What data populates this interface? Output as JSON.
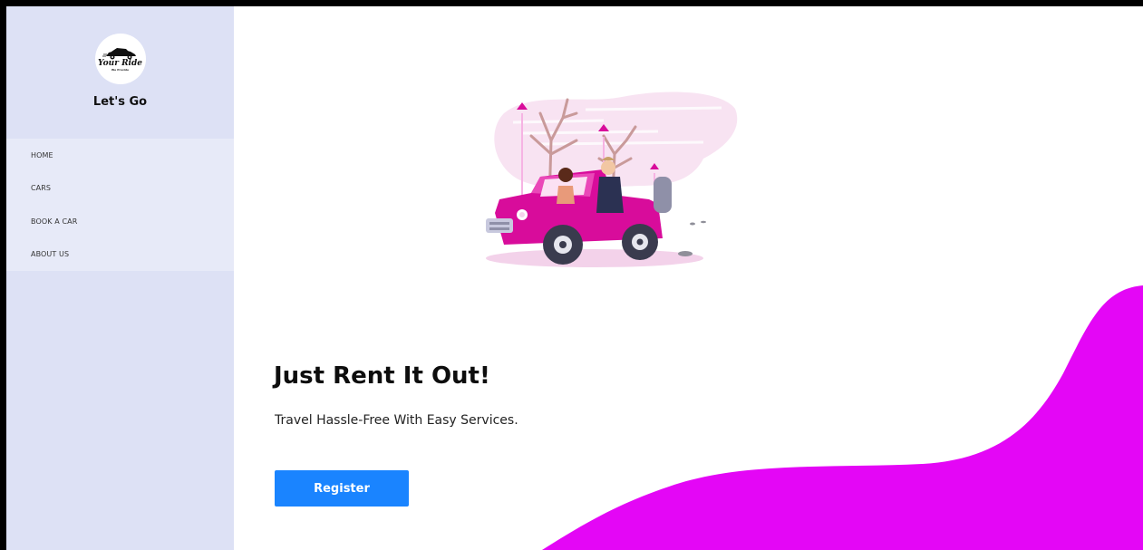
{
  "brand": {
    "logo_text": "Your Ride",
    "logo_subtext": "We Provide",
    "title": "Let's Go"
  },
  "nav": {
    "items": [
      {
        "label": "HOME"
      },
      {
        "label": "CARS"
      },
      {
        "label": "BOOK A CAR"
      },
      {
        "label": "ABOUT US"
      }
    ]
  },
  "hero": {
    "headline": "Just Rent It Out!",
    "tagline": "Travel Hassle-Free With Easy Services.",
    "register_label": "Register"
  },
  "colors": {
    "sidebar_bg": "#dde1f5",
    "nav_bg": "#e7eaf8",
    "accent_magenta": "#e406f6",
    "button_blue": "#1a84ff",
    "jeep_pink": "#d80c9b"
  },
  "icons": {
    "logo": "car-logo-icon",
    "hero_image": "jeep-couple-illustration"
  }
}
